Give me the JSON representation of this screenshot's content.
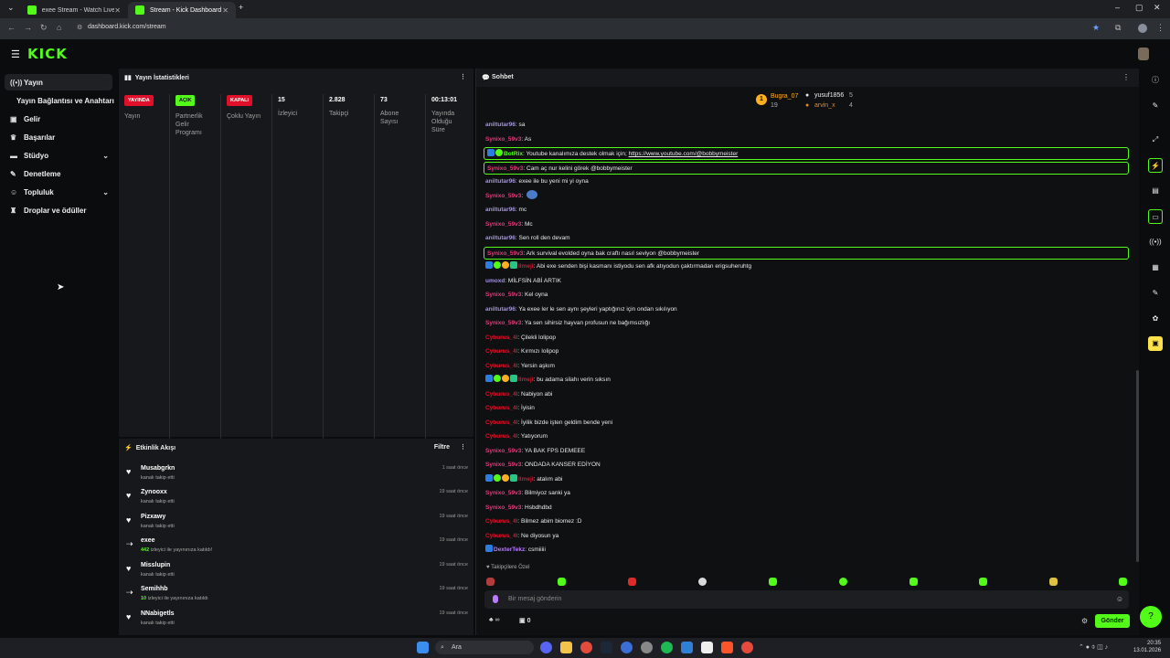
{
  "browser": {
    "tabs": [
      {
        "label": "exee Stream - Watch Live on Kick"
      },
      {
        "label": "Stream - Kick Dashboard"
      }
    ],
    "url": "dashboard.kick.com/stream"
  },
  "app": {
    "logo": "KICK"
  },
  "sidebar": {
    "items": [
      {
        "label": "Yayın",
        "icon": "broadcast-icon"
      },
      {
        "label": "Yayın Bağlantısı ve Anahtarı"
      },
      {
        "label": "Gelir",
        "icon": "wallet-icon"
      },
      {
        "label": "Başarılar",
        "icon": "trophy-icon"
      },
      {
        "label": "Stüdyo",
        "icon": "studio-icon"
      },
      {
        "label": "Denetleme",
        "icon": "wrench-icon"
      },
      {
        "label": "Topluluk",
        "icon": "people-icon"
      },
      {
        "label": "Droplar ve ödüller",
        "icon": "gift-icon"
      }
    ]
  },
  "stats": {
    "title": "Yayın İstatistikleri",
    "cols": [
      {
        "badge": "YAYINDA",
        "label": "Yayın"
      },
      {
        "badge": "AÇIK",
        "label": "Partnerlik Gelir Programı"
      },
      {
        "badge": "KAPALI",
        "label": "Çoklu Yayın"
      },
      {
        "value": "15",
        "label": "İzleyici"
      },
      {
        "value": "2.828",
        "label": "Takipçi"
      },
      {
        "value": "73",
        "label": "Abone Sayısı"
      },
      {
        "value": "00:13:01",
        "label": "Yayında Olduğu Süre"
      }
    ]
  },
  "activity": {
    "title": "Etkinlik Akışı",
    "filter": "Filtre",
    "items": [
      {
        "name": "Musabgrkn",
        "sub": "kanalı takip etti",
        "time": "1 saat önce"
      },
      {
        "name": "Zynooxx",
        "sub": "kanalı takip etti",
        "time": "19 saat önce"
      },
      {
        "name": "Pizxawy",
        "sub": "kanalı takip etti",
        "time": "19 saat önce"
      },
      {
        "name": "exee",
        "count": "442",
        "sub": "izleyici ile yayınınıza katıldı!",
        "time": "19 saat önce"
      },
      {
        "name": "Misslupin",
        "sub": "kanalı takip etti",
        "time": "19 saat önce"
      },
      {
        "name": "Semihhb",
        "count": "10",
        "sub": "izleyici ile yayınınıza katıldı",
        "time": "19 saat önce"
      },
      {
        "name": "NNabigetls",
        "sub": "kanalı takip etti",
        "time": "19 saat önce"
      }
    ]
  },
  "chat": {
    "title": "Sohbet",
    "pinned": [
      {
        "name": "Bugra_07",
        "count": "19"
      },
      {
        "name": "yusuf1856",
        "count": "5"
      },
      {
        "name": "arvin_x",
        "count": "4"
      }
    ],
    "messages": [
      {
        "user": "aniltutar96",
        "text": ": sa",
        "c": "v"
      },
      {
        "user": "Synixo_59v3",
        "text": ": As",
        "c": "p"
      },
      {
        "user": "BotRix",
        "text": ": Youtube kanalımıza destek olmak için; ",
        "link": "https://www.youtube.com/@bobbymeister",
        "c": "g",
        "hl": true,
        "badges": 2
      },
      {
        "user": "Synixo_59v3",
        "text": ": Cam aç nur kelini görek @bobbymeister",
        "c": "p",
        "hl": true
      },
      {
        "user": "aniltutar96",
        "text": ": exee ile bu yeni mi yi oyna",
        "c": "v"
      },
      {
        "user": "Synixo_59v3",
        "text": ":",
        "c": "p",
        "emote": true
      },
      {
        "user": "aniltutar96",
        "text": ": mc",
        "c": "v"
      },
      {
        "user": "Synixo_59v3",
        "text": ": Mc",
        "c": "p"
      },
      {
        "user": "aniltutar96",
        "text": ": Sen roll den devam",
        "c": "v"
      },
      {
        "user": "Synixo_59v3",
        "text": ": Ark survival evolded oyna bak craftı nasıl seviyon @bobbymeister",
        "c": "p",
        "hl": true
      },
      {
        "user": "Ilmeji",
        "text": ": Abi exe senden bişi kasmanı istiyodu sen afk atıyodun çaktırmadan erigsuheruhtg",
        "c": "r",
        "badges": 4
      },
      {
        "user": "umoxd",
        "text": ": MİLFSİN ABİ ARTIK",
        "c": "v"
      },
      {
        "user": "Synixo_59v3",
        "text": ": Kel oyna",
        "c": "p"
      },
      {
        "user": "aniltutar96",
        "text": ": Ya exee ler le sen aynı şeyleri yaptığınız için ondan sıkılıyon",
        "c": "v"
      },
      {
        "user": "Synixo_59v3",
        "text": ": Ya sen sihirsiz hayvan profusun ne bağımsızlığı",
        "c": "p"
      },
      {
        "user": "Cyburus_4l",
        "text": ": Çilekli lolipop",
        "c": "r"
      },
      {
        "user": "Cyburus_4l",
        "text": ": Kırmızı lolipop",
        "c": "r"
      },
      {
        "user": "Cyburus_4l",
        "text": ": Yersin aşkım",
        "c": "r"
      },
      {
        "user": "Ilmeji",
        "text": ": bu adama silahı verin sıksın",
        "c": "r",
        "badges": 4
      },
      {
        "user": "Cyburus_4l",
        "text": ": Nabiyon abi",
        "c": "r"
      },
      {
        "user": "Cyburus_4l",
        "text": ": İyisin",
        "c": "r"
      },
      {
        "user": "Cyburus_4l",
        "text": ": İyilik bizde işten geldim bende yeni",
        "c": "r"
      },
      {
        "user": "Cyburus_4l",
        "text": ": Yatıyorum",
        "c": "r"
      },
      {
        "user": "Synixo_59v3",
        "text": ": YA BAK FPS DEMEEE",
        "c": "p"
      },
      {
        "user": "Synixo_59v3",
        "text": ": ONDADA KANSER EDİYON",
        "c": "p"
      },
      {
        "user": "Ilmeji",
        "text": ": atalım abi",
        "c": "r",
        "badges": 4
      },
      {
        "user": "Synixo_59v3",
        "text": ": Bilmiyoz sanki ya",
        "c": "p"
      },
      {
        "user": "Synixo_59v3",
        "text": ": Hsbdhdbd",
        "c": "p"
      },
      {
        "user": "Cyburus_4l",
        "text": ": Bilmez abim biomez :D",
        "c": "r"
      },
      {
        "user": "Cyburus_4l",
        "text": ": Ne diyosun ya",
        "c": "r"
      },
      {
        "user": "DexterTekz",
        "text": ": csmiiiii",
        "c": "pu",
        "badges": 1
      }
    ],
    "followers_only": "Takipçilere Özel",
    "input_placeholder": "Bir mesaj gönderin",
    "counter1": "∞",
    "counter2": "0",
    "send": "Gönder"
  },
  "taskbar": {
    "search": "Ara",
    "time": "20:35",
    "date": "13.01.2026"
  }
}
